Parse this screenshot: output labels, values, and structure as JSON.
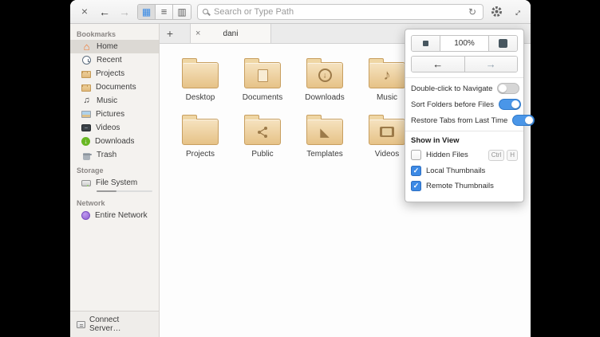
{
  "toolbar": {
    "search_placeholder": "Search or Type Path"
  },
  "sidebar": {
    "sections": [
      {
        "header": "Bookmarks",
        "items": [
          {
            "label": "Home",
            "icon": "home-icon"
          },
          {
            "label": "Recent",
            "icon": "clock-icon"
          },
          {
            "label": "Projects",
            "icon": "folder-icon"
          },
          {
            "label": "Documents",
            "icon": "folder-icon"
          },
          {
            "label": "Music",
            "icon": "music-note-icon"
          },
          {
            "label": "Pictures",
            "icon": "photo-icon"
          },
          {
            "label": "Videos",
            "icon": "film-icon"
          },
          {
            "label": "Downloads",
            "icon": "download-circle-icon"
          },
          {
            "label": "Trash",
            "icon": "trash-icon"
          }
        ]
      },
      {
        "header": "Storage",
        "items": [
          {
            "label": "File System",
            "icon": "harddrive-icon"
          }
        ]
      },
      {
        "header": "Network",
        "items": [
          {
            "label": "Entire Network",
            "icon": "network-globe-icon"
          }
        ]
      }
    ],
    "connect_server": "Connect Server…"
  },
  "tabbar": {
    "active_tab": "dani"
  },
  "files": [
    {
      "name": "Desktop",
      "icon": "plain-folder"
    },
    {
      "name": "Documents",
      "icon": "document-folder"
    },
    {
      "name": "Downloads",
      "icon": "download-folder"
    },
    {
      "name": "Music",
      "icon": "music-folder"
    },
    {
      "name": "Projects",
      "icon": "plain-folder"
    },
    {
      "name": "Public",
      "icon": "share-folder"
    },
    {
      "name": "Templates",
      "icon": "templates-folder"
    },
    {
      "name": "Videos",
      "icon": "video-folder"
    }
  ],
  "popover": {
    "zoom_value": "100%",
    "toggles": [
      {
        "label": "Double-click to Navigate",
        "on": false
      },
      {
        "label": "Sort Folders before Files",
        "on": true
      },
      {
        "label": "Restore Tabs from Last Time",
        "on": true
      }
    ],
    "show_in_view": {
      "header": "Show in View",
      "options": [
        {
          "label": "Hidden Files",
          "checked": false,
          "shortcut": [
            "Ctrl",
            "H"
          ]
        },
        {
          "label": "Local Thumbnails",
          "checked": true
        },
        {
          "label": "Remote Thumbnails",
          "checked": true
        }
      ]
    }
  },
  "colors": {
    "accent": "#3689e6",
    "folder_body": "#e6c287",
    "downloads_green": "#68b723",
    "home_orange": "#f37329",
    "network_purple": "#8d5fd0"
  }
}
